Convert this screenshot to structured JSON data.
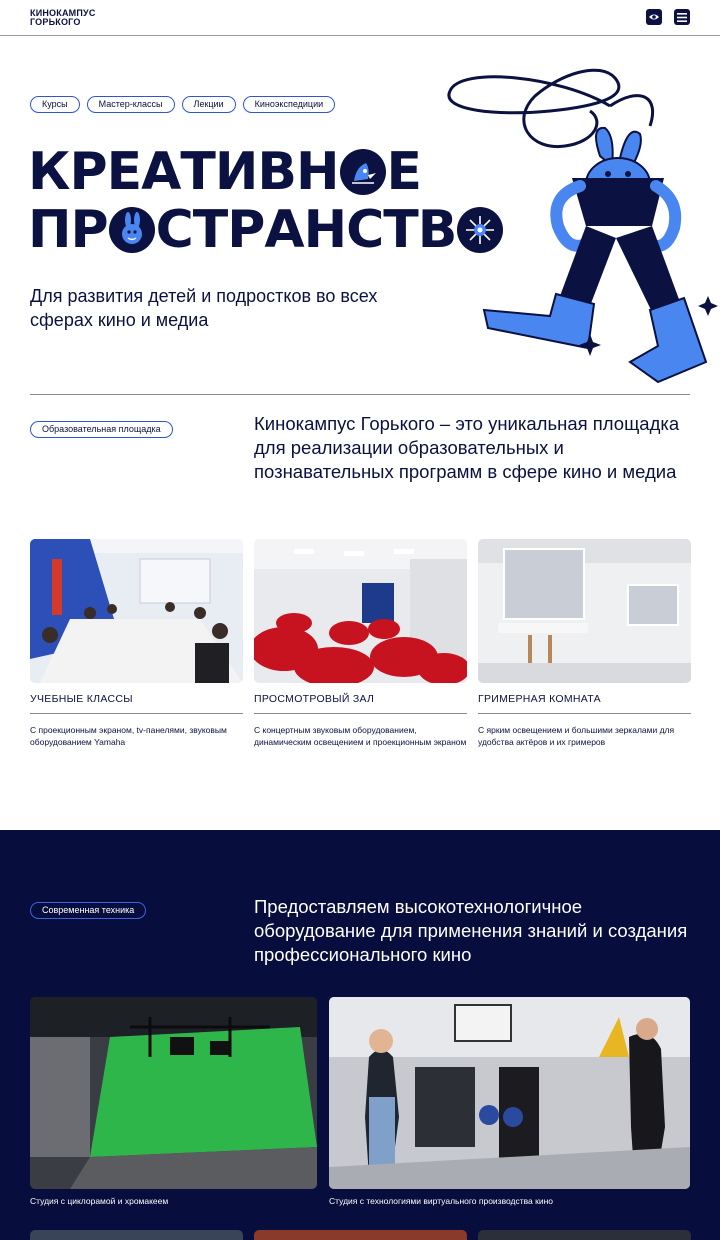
{
  "header": {
    "logo_line1": "КИНОКАМПУС",
    "logo_line2": "ГОРЬКОГО",
    "eye_button_icon": "eye-icon",
    "menu_button_icon": "menu-icon"
  },
  "hero": {
    "tags": [
      "Курсы",
      "Мастер-классы",
      "Лекции",
      "Киноэкспедиции"
    ],
    "title_line1_a": "КРЕАТИВН",
    "title_line1_b": "Е",
    "title_line2_a": "ПР",
    "title_line2_b": "СТРАНСТВ",
    "subtitle": "Для развития детей и подростков во всех сферах кино и медиа"
  },
  "intro": {
    "pill": "Образовательная площадка",
    "text": "Кинокампус Горького – это уникальная площадка для реализации образовательных и познавательных программ в сфере кино и медиа"
  },
  "cards": [
    {
      "title": "УЧЕБНЫЕ КЛАССЫ",
      "desc": "С проекционным экраном, tv-панелями, звуковым оборудованием Yamaha"
    },
    {
      "title": "ПРОСМОТРОВЫЙ ЗАЛ",
      "desc": "С концертным звуковым оборудованием, динамическим освещением и проекционным экраном"
    },
    {
      "title": "ГРИМЕРНАЯ КОМНАТА",
      "desc": "С ярким освещением и большими зеркалами для удобства актёров и их гримеров"
    }
  ],
  "tech": {
    "pill": "Современная техника",
    "text": "Предоставляем высокотехнологичное оборудование для применения знаний и создания профессионального кино",
    "photos": [
      {
        "caption": "Студия с циклорамой и хромакеем"
      },
      {
        "caption": "Студия с технологиями виртуального производства кино"
      }
    ]
  },
  "colors": {
    "navy": "#0b1140",
    "accent_blue": "#4a86f0",
    "dark_section": "#070d3d"
  }
}
